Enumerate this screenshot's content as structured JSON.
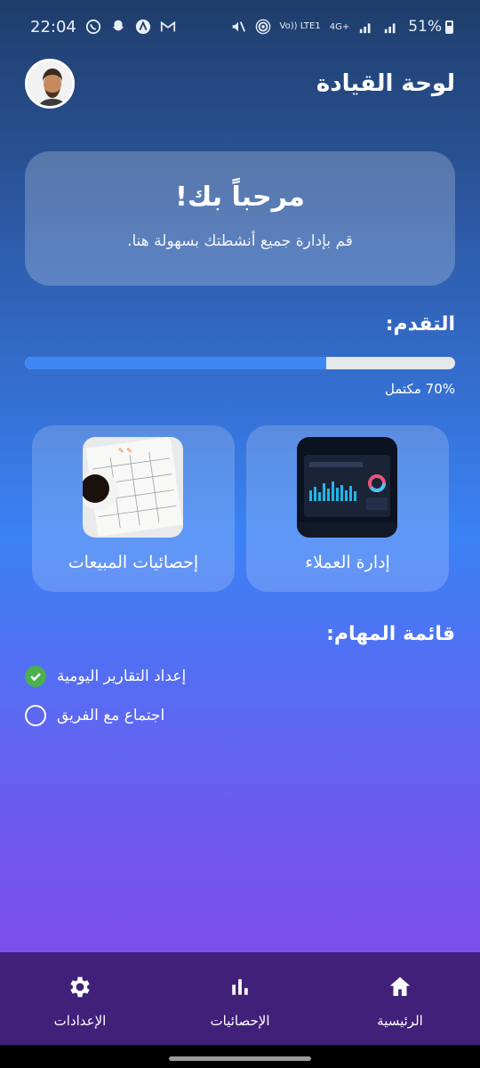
{
  "status_bar": {
    "time": "22:04",
    "network_text": "Vo)) LTE1",
    "network_gen": "4G+",
    "battery": "51%"
  },
  "header": {
    "title": "لوحة القيادة"
  },
  "welcome": {
    "title": "مرحباً بك!",
    "subtitle": "قم بإدارة جميع أنشطتك بسهولة هنا."
  },
  "progress": {
    "title": "التقدم:",
    "value": 0.7,
    "text": "70% مكتمل"
  },
  "cards": [
    {
      "label": "إدارة العملاء",
      "image_icon": "dashboard-screen-image"
    },
    {
      "label": "إحصائيات المبيعات",
      "image_icon": "calendar-coffee-image"
    }
  ],
  "tasks": {
    "title": "قائمة المهام:",
    "items": [
      {
        "label": "إعداد التقارير اليومية",
        "done": true
      },
      {
        "label": "اجتماع مع الفريق",
        "done": false
      }
    ]
  },
  "bottom_nav": {
    "items": [
      {
        "label": "الإعدادات",
        "icon": "gear-icon"
      },
      {
        "label": "الإحصائيات",
        "icon": "bar-chart-icon"
      },
      {
        "label": "الرئيسية",
        "icon": "home-icon"
      }
    ]
  },
  "colors": {
    "progress_fill": "#3e86f3",
    "check_green": "#4caf50",
    "nav_bg": "#402079"
  }
}
